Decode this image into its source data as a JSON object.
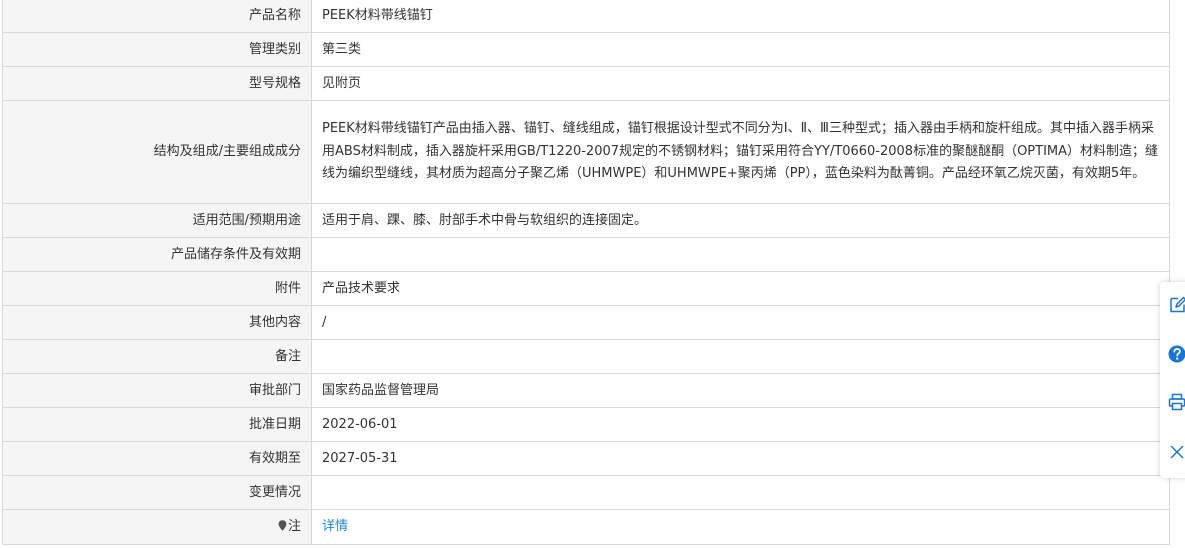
{
  "rows": [
    {
      "label": "产品名称",
      "value": "PEEK材料带线锚钉"
    },
    {
      "label": "管理类别",
      "value": "第三类"
    },
    {
      "label": "型号规格",
      "value": "见附页"
    },
    {
      "label": "结构及组成/主要组成成分",
      "value": "PEEK材料带线锚钉产品由插入器、锚钉、缝线组成，锚钉根据设计型式不同分为Ⅰ、Ⅱ、Ⅲ三种型式；插入器由手柄和旋杆组成。其中插入器手柄采用ABS材料制成，插入器旋杆采用GB/T1220-2007规定的不锈钢材料；锚钉采用符合YY/T0660-2008标准的聚醚醚酮（OPTIMA）材料制造；缝线为编织型缝线，其材质为超高分子聚乙烯（UHMWPE）和UHMWPE+聚丙烯（PP），蓝色染料为酞菁铜。产品经环氧乙烷灭菌，有效期5年。"
    },
    {
      "label": "适用范围/预期用途",
      "value": "适用于肩、踝、膝、肘部手术中骨与软组织的连接固定。"
    },
    {
      "label": "产品储存条件及有效期",
      "value": ""
    },
    {
      "label": "附件",
      "value": "产品技术要求"
    },
    {
      "label": "其他内容",
      "value": "/"
    },
    {
      "label": "备注",
      "value": ""
    },
    {
      "label": "审批部门",
      "value": "国家药品监督管理局"
    },
    {
      "label": "批准日期",
      "value": "2022-06-01"
    },
    {
      "label": "有效期至",
      "value": "2027-05-31"
    },
    {
      "label": "变更情况",
      "value": ""
    }
  ],
  "note_row": {
    "label": "注",
    "icon": "location-pin-icon",
    "link": "详情"
  },
  "toolbar": {
    "items": [
      "edit-icon",
      "help-icon",
      "print-icon",
      "close-icon"
    ]
  },
  "colors": {
    "label_bg": "#f5f5f5",
    "border": "#d9d9d9",
    "link": "#1e88e5",
    "toolbar_icon": "#1976d2"
  }
}
